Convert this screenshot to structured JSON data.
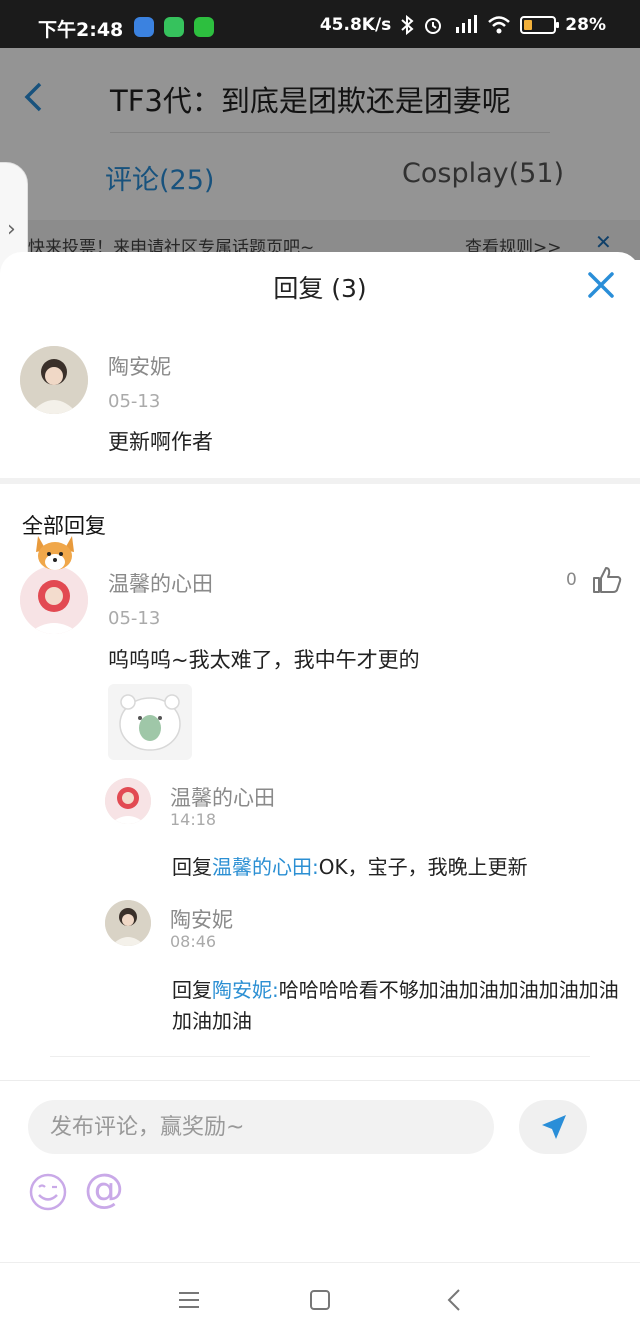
{
  "status_bar": {
    "time": "下午2:48",
    "network_speed": "45.8K/s",
    "battery": "28%",
    "battery_level": 0.28
  },
  "page": {
    "title": "TF3代：到底是团欺还是团妻呢",
    "tabs": [
      {
        "label": "评论(25)",
        "active": true
      },
      {
        "label": "Cosplay(51)",
        "active": false
      }
    ],
    "notice": {
      "text": "快来投票！来申请社区专属话题页吧~",
      "rule_link": "查看规则>>"
    }
  },
  "sheet": {
    "title": "回复 (3)",
    "comment": {
      "author": "陶安妮",
      "date": "05-13",
      "text": "更新啊作者"
    },
    "section_title": "全部回复",
    "reply": {
      "author": "温馨的心田",
      "date": "05-13",
      "likes": "0",
      "text": "呜呜呜~我太难了，我中午才更的"
    },
    "sub_replies": [
      {
        "author": "温馨的心田",
        "time": "14:18",
        "prefix": "回复",
        "target": "温馨的心田:",
        "text": "OK，宝子，我晚上更新"
      },
      {
        "author": "陶安妮",
        "time": "08:46",
        "prefix": "回复",
        "target": "陶安妮:",
        "text": "哈哈哈哈看不够加油加油加油加油加油加油加油"
      }
    ]
  },
  "composer": {
    "placeholder": "发布评论，赢奖励~",
    "at_symbol": "@"
  },
  "colors": {
    "accent": "#2a8ed8",
    "link": "#2b8fd3",
    "close": "#2a8ed8"
  }
}
